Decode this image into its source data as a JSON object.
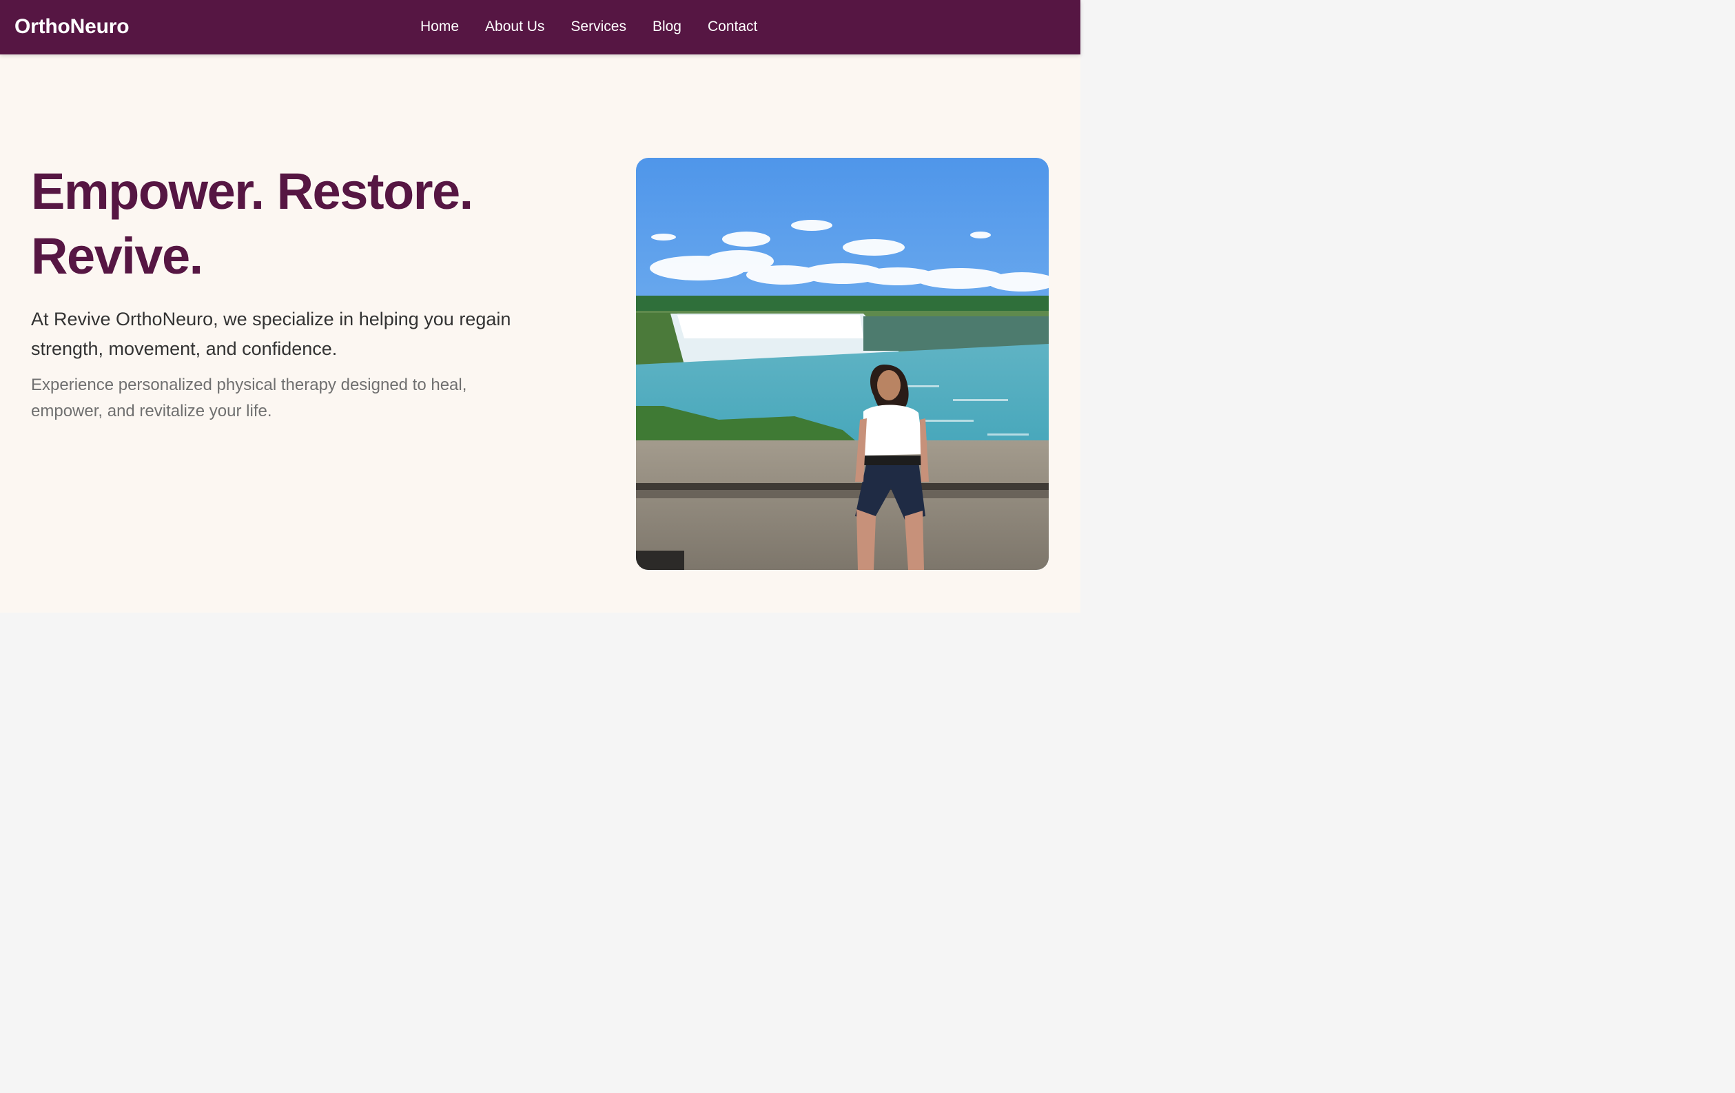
{
  "brand": "OrthoNeuro",
  "nav": {
    "items": [
      "Home",
      "About Us",
      "Services",
      "Blog",
      "Contact"
    ]
  },
  "hero": {
    "headline_line1": "Empower. Restore.",
    "headline_line2": "Revive.",
    "lead": "At Revive OrthoNeuro, we specialize in helping you regain strength, movement, and confidence.",
    "sub": "Experience personalized physical therapy designed to heal, empower, and revitalize your life."
  },
  "colors": {
    "brand": "#561643",
    "hero_bg": "#fcf7f2",
    "page_bg": "#f5f5f5"
  }
}
